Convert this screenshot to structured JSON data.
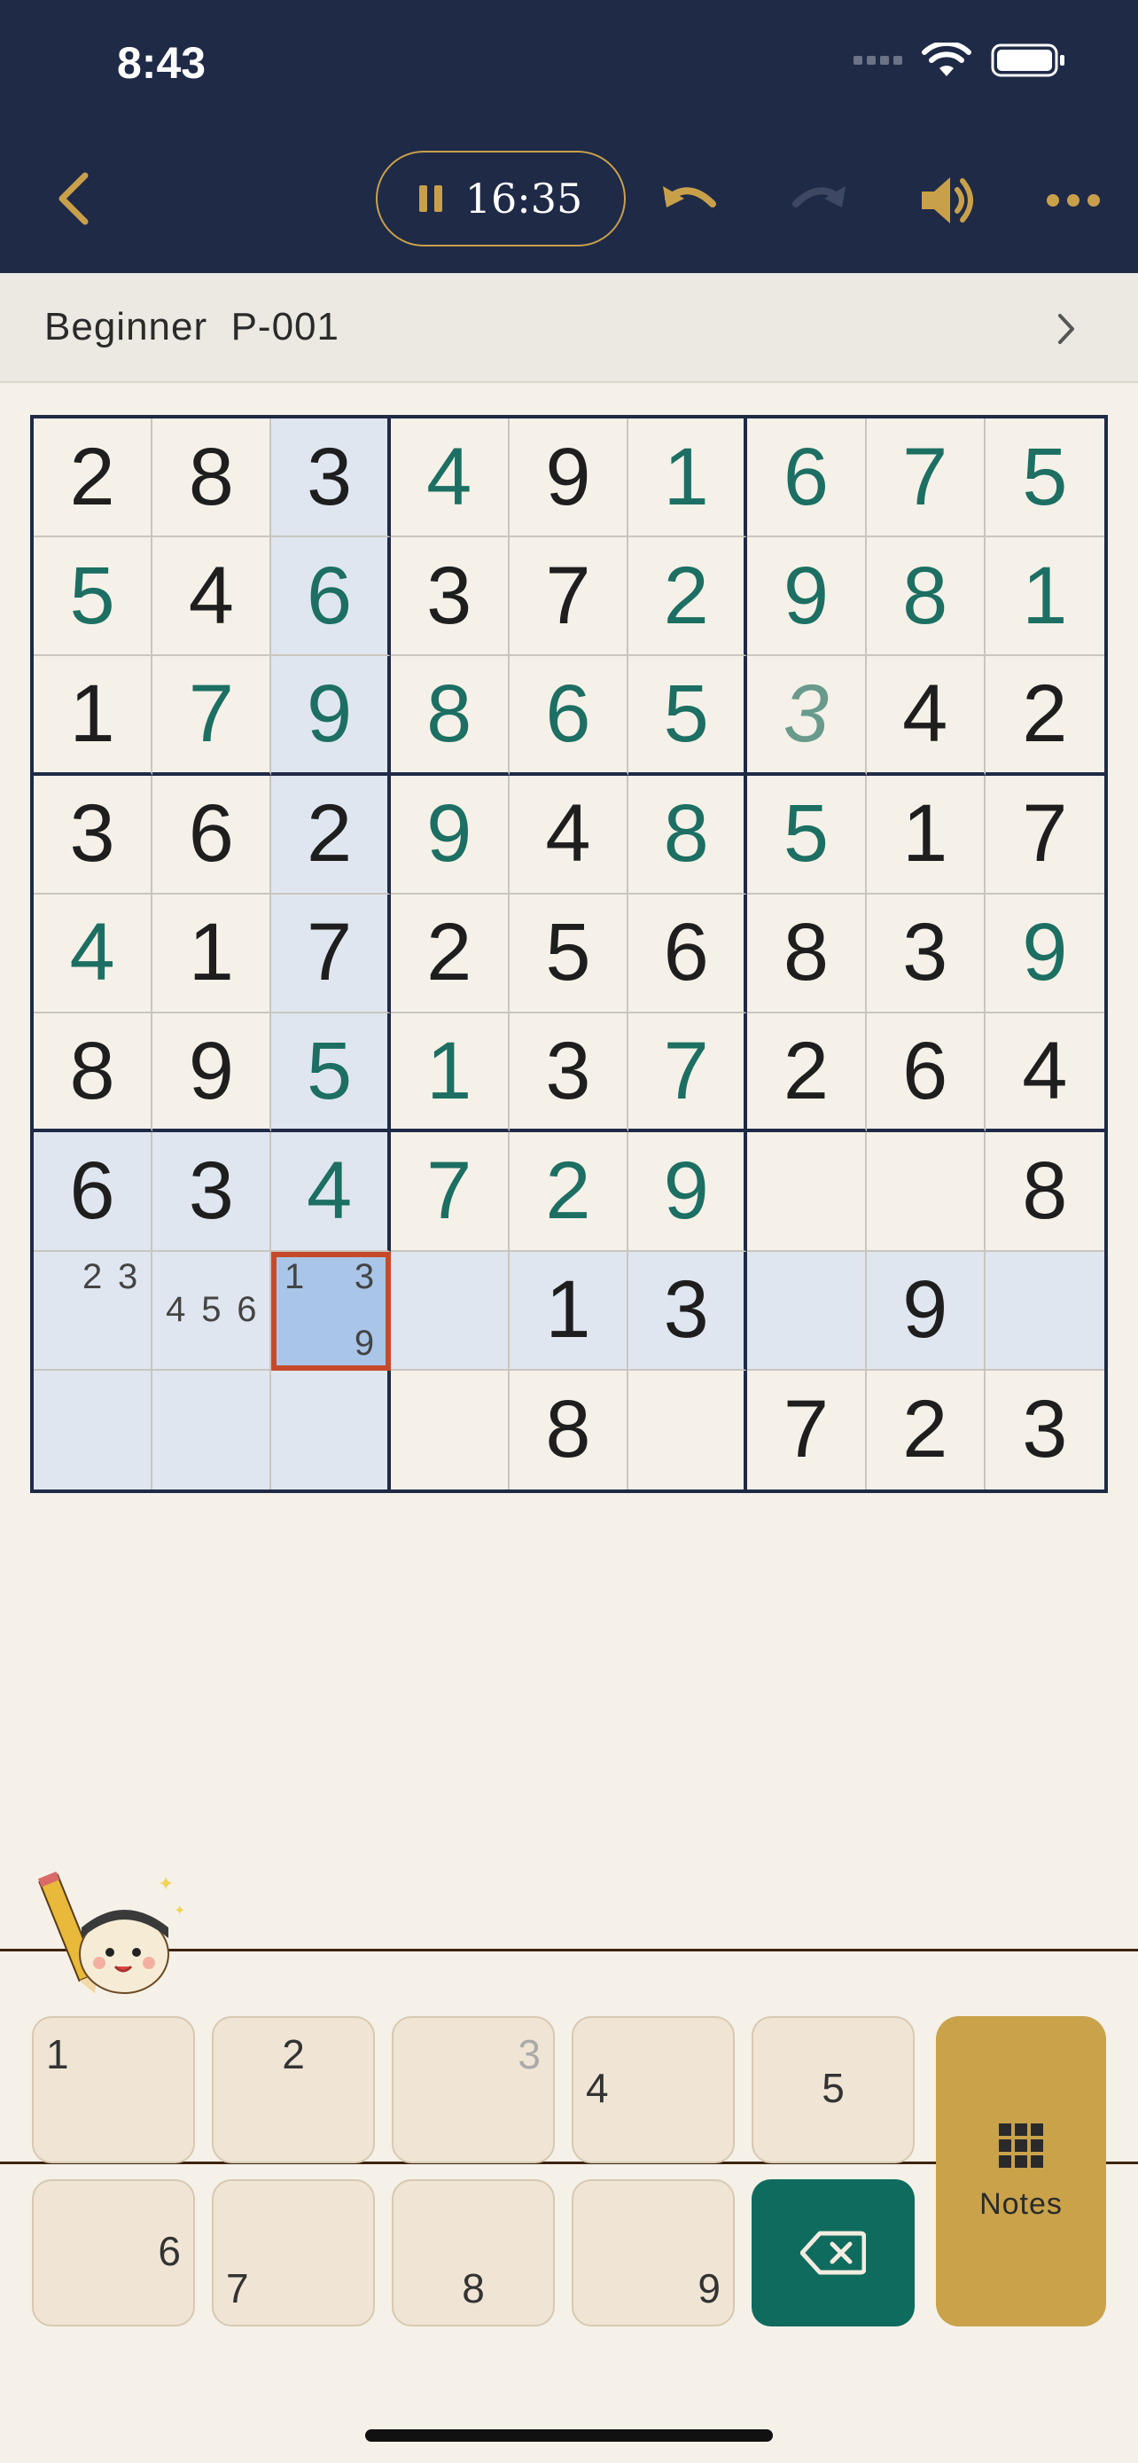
{
  "status_bar": {
    "time": "8:43"
  },
  "toolbar": {
    "timer": "16:35"
  },
  "level": {
    "title": "Beginner  P-001"
  },
  "grid": {
    "cells": [
      [
        "2",
        "8",
        "3",
        "4",
        "9",
        "1",
        "6",
        "7",
        "5"
      ],
      [
        "5",
        "4",
        "6",
        "3",
        "7",
        "2",
        "9",
        "8",
        "1"
      ],
      [
        "1",
        "7",
        "9",
        "8",
        "6",
        "5",
        "3",
        "4",
        "2"
      ],
      [
        "3",
        "6",
        "2",
        "9",
        "4",
        "8",
        "5",
        "1",
        "7"
      ],
      [
        "4",
        "1",
        "7",
        "2",
        "5",
        "6",
        "8",
        "3",
        "9"
      ],
      [
        "8",
        "9",
        "5",
        "1",
        "3",
        "7",
        "2",
        "6",
        "4"
      ],
      [
        "6",
        "3",
        "4",
        "7",
        "2",
        "9",
        "",
        "",
        "8"
      ],
      [
        "",
        "",
        "",
        "",
        "1",
        "3",
        "",
        "9",
        ""
      ],
      [
        "",
        "",
        "",
        "",
        "8",
        "",
        "7",
        "2",
        "3"
      ]
    ],
    "kinds": [
      [
        "g",
        "g",
        "g",
        "u",
        "g",
        "u",
        "u",
        "u",
        "u"
      ],
      [
        "u",
        "g",
        "u",
        "g",
        "g",
        "u",
        "u",
        "u",
        "u"
      ],
      [
        "g",
        "u",
        "u",
        "u",
        "u",
        "u",
        "h",
        "g",
        "g"
      ],
      [
        "g",
        "g",
        "g",
        "u",
        "g",
        "u",
        "u",
        "g",
        "g"
      ],
      [
        "u",
        "g",
        "g",
        "g",
        "g",
        "g",
        "g",
        "g",
        "u"
      ],
      [
        "g",
        "g",
        "u",
        "u",
        "g",
        "u",
        "g",
        "g",
        "g"
      ],
      [
        "g",
        "g",
        "u",
        "u",
        "u",
        "u",
        "",
        "",
        "g"
      ],
      [
        "",
        "",
        "",
        "",
        "g",
        "g",
        "",
        "g",
        ""
      ],
      [
        "",
        "",
        "",
        "",
        "g",
        "",
        "g",
        "g",
        "g"
      ]
    ],
    "notes": {
      "7-0": [
        "",
        "2",
        "3",
        "",
        "",
        "",
        "",
        "",
        ""
      ],
      "7-1": [
        "",
        "",
        "",
        "4",
        "5",
        "6",
        "",
        "",
        ""
      ],
      "7-2": [
        "1",
        "",
        "3",
        "",
        "",
        "",
        "",
        "",
        "9"
      ]
    },
    "selected": "7-2"
  },
  "keypad": {
    "keys": [
      {
        "label": "1",
        "pos": "tl",
        "faded": false
      },
      {
        "label": "2",
        "pos": "tc",
        "faded": false
      },
      {
        "label": "3",
        "pos": "tr",
        "faded": true
      },
      {
        "label": "4",
        "pos": "ml",
        "faded": false
      },
      {
        "label": "5",
        "pos": "mc",
        "faded": false
      },
      {
        "label": "6",
        "pos": "mr",
        "faded": false
      },
      {
        "label": "7",
        "pos": "bl",
        "faded": false
      },
      {
        "label": "8",
        "pos": "bc",
        "faded": false
      },
      {
        "label": "9",
        "pos": "br",
        "faded": false
      }
    ],
    "notes_label": "Notes",
    "delete_icon": "backspace-icon"
  },
  "colors": {
    "header_bg": "#1f2a47",
    "accent_gold": "#c9a04a",
    "user_digit": "#1c6f62",
    "selection_border": "#c64a2a",
    "highlight": "#dfe6ef"
  }
}
